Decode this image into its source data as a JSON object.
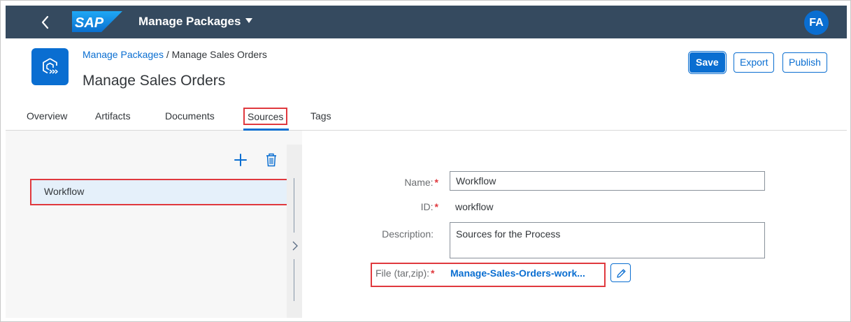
{
  "shell": {
    "brand": "SAP",
    "app_title": "Manage Packages",
    "avatar_initials": "FA"
  },
  "header": {
    "breadcrumb_link": "Manage Packages",
    "breadcrumb_separator": " / ",
    "breadcrumb_current": "Manage Sales Orders",
    "title": "Manage Sales Orders",
    "actions": {
      "save": "Save",
      "export": "Export",
      "publish": "Publish"
    }
  },
  "tabs": {
    "overview": "Overview",
    "artifacts": "Artifacts",
    "documents": "Documents",
    "sources": "Sources",
    "tags": "Tags",
    "selected": "Sources"
  },
  "master": {
    "items": [
      {
        "label": "Workflow",
        "selected": true
      }
    ]
  },
  "form": {
    "name_label": "Name:",
    "name_value": "Workflow",
    "id_label": "ID:",
    "id_value": "workflow",
    "description_label": "Description:",
    "description_value": "Sources for the Process",
    "file_label": "File (tar,zip):",
    "file_value": "Manage-Sales-Orders-work...",
    "required_marker": "*"
  },
  "colors": {
    "shell_bg": "#354a5f",
    "accent": "#0a6ed1",
    "highlight_box": "#e0393e",
    "selected_item_bg": "#e5f0fa"
  }
}
